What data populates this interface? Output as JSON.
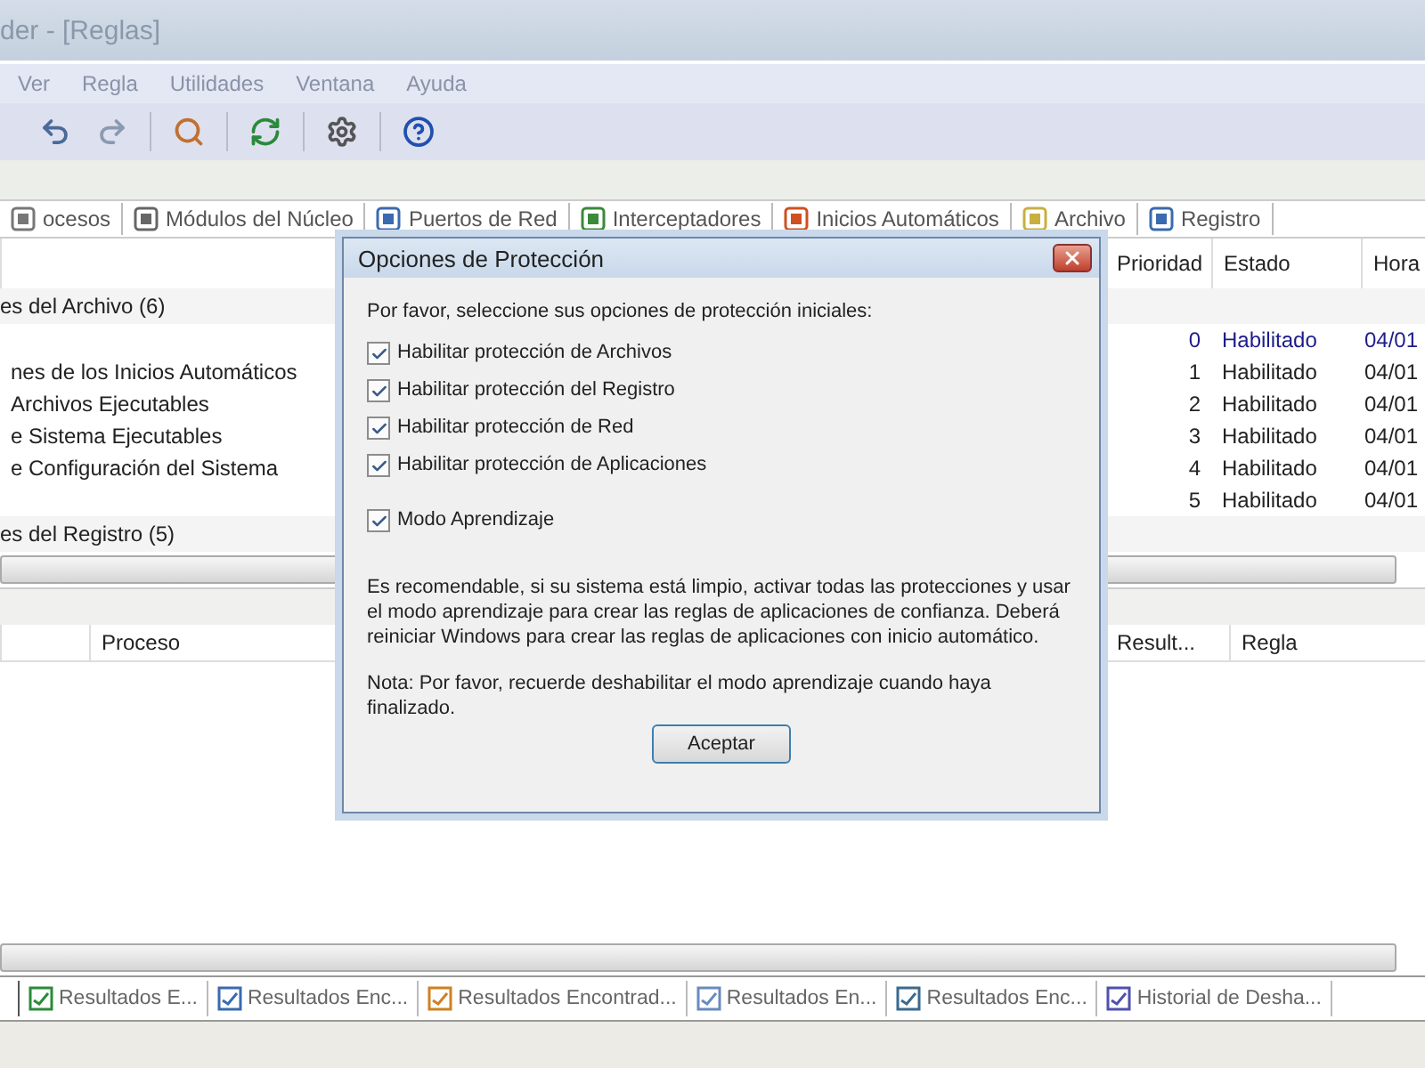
{
  "window": {
    "title": "der - [Reglas]"
  },
  "menu": [
    "Ver",
    "Regla",
    "Utilidades",
    "Ventana",
    "Ayuda"
  ],
  "view_tabs": [
    {
      "label": "ocesos",
      "selected": false
    },
    {
      "label": "Módulos del Núcleo",
      "selected": false
    },
    {
      "label": "Puertos de Red",
      "selected": false
    },
    {
      "label": "Interceptadores",
      "selected": false
    },
    {
      "label": "Inicios Automáticos",
      "selected": false
    },
    {
      "label": "Archivo",
      "selected": false
    },
    {
      "label": "Registro",
      "selected": false
    }
  ],
  "rules_table": {
    "columns": [
      "Prioridad",
      "Estado",
      "Hora"
    ],
    "rows": [
      {
        "kind": "group",
        "name": "es del Archivo (6)"
      },
      {
        "kind": "rule",
        "name": "",
        "priority": "0",
        "state": "Habilitado",
        "time": "04/01",
        "selected": true
      },
      {
        "kind": "rule",
        "name": "nes de los Inicios Automáticos",
        "priority": "1",
        "state": "Habilitado",
        "time": "04/01",
        "selected": false
      },
      {
        "kind": "rule",
        "name": "Archivos Ejecutables",
        "priority": "2",
        "state": "Habilitado",
        "time": "04/01",
        "selected": false
      },
      {
        "kind": "rule",
        "name": "e Sistema Ejecutables",
        "priority": "3",
        "state": "Habilitado",
        "time": "04/01",
        "selected": false
      },
      {
        "kind": "rule",
        "name": "e Configuración del Sistema",
        "priority": "4",
        "state": "Habilitado",
        "time": "04/01",
        "selected": false
      },
      {
        "kind": "rule",
        "name": "",
        "priority": "5",
        "state": "Habilitado",
        "time": "04/01",
        "selected": false
      },
      {
        "kind": "group",
        "name": "es del Registro (5)"
      }
    ]
  },
  "results_table": {
    "columns": [
      "Proceso",
      "Result...",
      "Regla"
    ]
  },
  "result_tabs": [
    {
      "label": "Resultados E...",
      "selected": true
    },
    {
      "label": "Resultados Enc...",
      "selected": false
    },
    {
      "label": "Resultados Encontrad...",
      "selected": false
    },
    {
      "label": "Resultados En...",
      "selected": false
    },
    {
      "label": "Resultados Enc...",
      "selected": false
    },
    {
      "label": "Historial de Desha...",
      "selected": false
    }
  ],
  "dialog": {
    "title": "Opciones de Protección",
    "intro": "Por favor, seleccione sus opciones de protección iniciales:",
    "options": [
      {
        "label": "Habilitar protección de Archivos",
        "checked": true
      },
      {
        "label": "Habilitar protección del Registro",
        "checked": true
      },
      {
        "label": "Habilitar protección de Red",
        "checked": true
      },
      {
        "label": "Habilitar protección de Aplicaciones",
        "checked": true
      }
    ],
    "learning": {
      "label": "Modo Aprendizaje",
      "checked": true
    },
    "advice": "Es recomendable, si su sistema está limpio, activar todas las protecciones y usar el modo aprendizaje para crear las reglas de aplicaciones de confianza. Deberá reiniciar Windows para crear las reglas de aplicaciones con inicio automático.",
    "note": "Nota: Por favor, recuerde deshabilitar el modo aprendizaje cuando haya finalizado.",
    "button": "Aceptar"
  }
}
